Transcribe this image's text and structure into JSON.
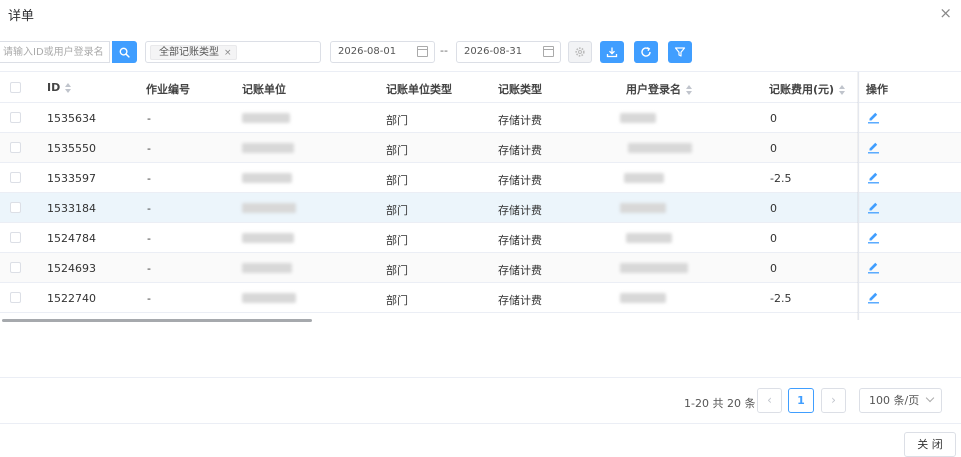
{
  "dialog": {
    "title": "详单",
    "close_icon": "×"
  },
  "toolbar": {
    "search_placeholder": "请输入ID或用户登录名",
    "type_tag": "全部记账类型",
    "tag_close": "×",
    "date_start": "2026-08-01",
    "date_sep": "--",
    "date_end": "2026-08-31",
    "icons": [
      "search-icon",
      "settings-icon",
      "download-icon",
      "refresh-icon",
      "filter-icon"
    ]
  },
  "table": {
    "columns": [
      "ID",
      "作业编号",
      "记账单位",
      "记账单位类型",
      "记账类型",
      "用户登录名",
      "记账费用(元)",
      "操作"
    ],
    "rows": [
      {
        "id": "1535634",
        "job": "-",
        "unit_type": "部门",
        "type": "存储计费",
        "fee": "0"
      },
      {
        "id": "1535550",
        "job": "-",
        "unit_type": "部门",
        "type": "存储计费",
        "fee": "0"
      },
      {
        "id": "1533597",
        "job": "-",
        "unit_type": "部门",
        "type": "存储计费",
        "fee": "-2.5"
      },
      {
        "id": "1533184",
        "job": "-",
        "unit_type": "部门",
        "type": "存储计费",
        "fee": "0"
      },
      {
        "id": "1524784",
        "job": "-",
        "unit_type": "部门",
        "type": "存储计费",
        "fee": "0"
      },
      {
        "id": "1524693",
        "job": "-",
        "unit_type": "部门",
        "type": "存储计费",
        "fee": "0"
      },
      {
        "id": "1522740",
        "job": "-",
        "unit_type": "部门",
        "type": "存储计费",
        "fee": "-2.5"
      }
    ]
  },
  "pagination": {
    "total": "1-20 共 20 条",
    "prev": "‹",
    "current": "1",
    "next": "›",
    "page_size": "100 条/页"
  },
  "footer": {
    "close_label": "关 闭"
  },
  "colors": {
    "primary": "#409eff",
    "highlight_row": "#ecf5fb"
  }
}
